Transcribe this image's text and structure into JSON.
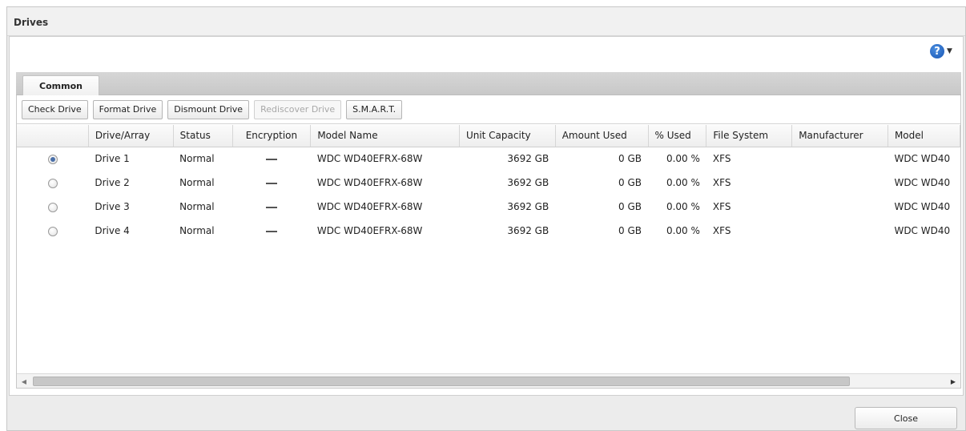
{
  "window": {
    "title": "Drives"
  },
  "help": {
    "icon": "help-icon",
    "caret_icon": "chevron-down-icon"
  },
  "tabs": [
    {
      "label": "Common",
      "active": true
    }
  ],
  "toolbar": {
    "check_drive": "Check Drive",
    "format_drive": "Format Drive",
    "dismount_drive": "Dismount Drive",
    "rediscover_drive": "Rediscover Drive",
    "smart": "S.M.A.R.T."
  },
  "table": {
    "columns": [
      "",
      "Drive/Array",
      "Status",
      "Encryption",
      "Model Name",
      "Unit Capacity",
      "Amount Used",
      "% Used",
      "File System",
      "Manufacturer",
      "Model"
    ],
    "rows": [
      {
        "selected": true,
        "drive": "Drive 1",
        "status": "Normal",
        "encryption": "—",
        "model_name": "WDC WD40EFRX-68W",
        "capacity": "3692 GB",
        "used": "0 GB",
        "pct_used": "0.00 %",
        "fs": "XFS",
        "manufacturer": "",
        "model": "WDC WD40"
      },
      {
        "selected": false,
        "drive": "Drive 2",
        "status": "Normal",
        "encryption": "—",
        "model_name": "WDC WD40EFRX-68W",
        "capacity": "3692 GB",
        "used": "0 GB",
        "pct_used": "0.00 %",
        "fs": "XFS",
        "manufacturer": "",
        "model": "WDC WD40"
      },
      {
        "selected": false,
        "drive": "Drive 3",
        "status": "Normal",
        "encryption": "—",
        "model_name": "WDC WD40EFRX-68W",
        "capacity": "3692 GB",
        "used": "0 GB",
        "pct_used": "0.00 %",
        "fs": "XFS",
        "manufacturer": "",
        "model": "WDC WD40"
      },
      {
        "selected": false,
        "drive": "Drive 4",
        "status": "Normal",
        "encryption": "—",
        "model_name": "WDC WD40EFRX-68W",
        "capacity": "3692 GB",
        "used": "0 GB",
        "pct_used": "0.00 %",
        "fs": "XFS",
        "manufacturer": "",
        "model": "WDC WD40"
      }
    ]
  },
  "footer": {
    "close_label": "Close"
  },
  "colors": {
    "accent": "#1a56b3",
    "radio_dot": "#4a6fa8"
  }
}
